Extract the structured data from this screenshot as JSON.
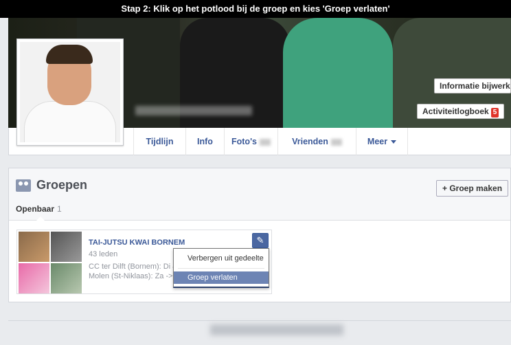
{
  "banner": {
    "text": "Stap 2: Klik op het potlood bij de groep en kies 'Groep verlaten'"
  },
  "cover": {
    "update_info_label": "Informatie bijwerken",
    "activity_log_label": "Activiteitlogboek",
    "activity_log_badge": "5"
  },
  "nav": {
    "tabs": [
      "Tijdlijn",
      "Info",
      "Foto's",
      "Vrienden",
      "Meer"
    ]
  },
  "groups": {
    "title": "Groepen",
    "new_group_label": "+ Groep maken",
    "subtab_label": "Openbaar",
    "subtab_count": "1",
    "card": {
      "name": "TAI-JUTSU KWAI BORNEM",
      "members": "43 leden",
      "desc_line1": "CC ter Dilft (Bornem): Di & D",
      "desc_line2": "Molen (St-Niklaas): Za ->..."
    },
    "menu": {
      "hide_label": "Verbergen uit gedeelte",
      "leave_label": "Groep verlaten"
    }
  },
  "colors": {
    "accent": "#3b5998",
    "highlight": "#6d84b4",
    "badge": "#e0332a"
  },
  "icons": {
    "edit": "pencil-icon",
    "groups": "groups-icon",
    "more": "caret-down-icon"
  }
}
